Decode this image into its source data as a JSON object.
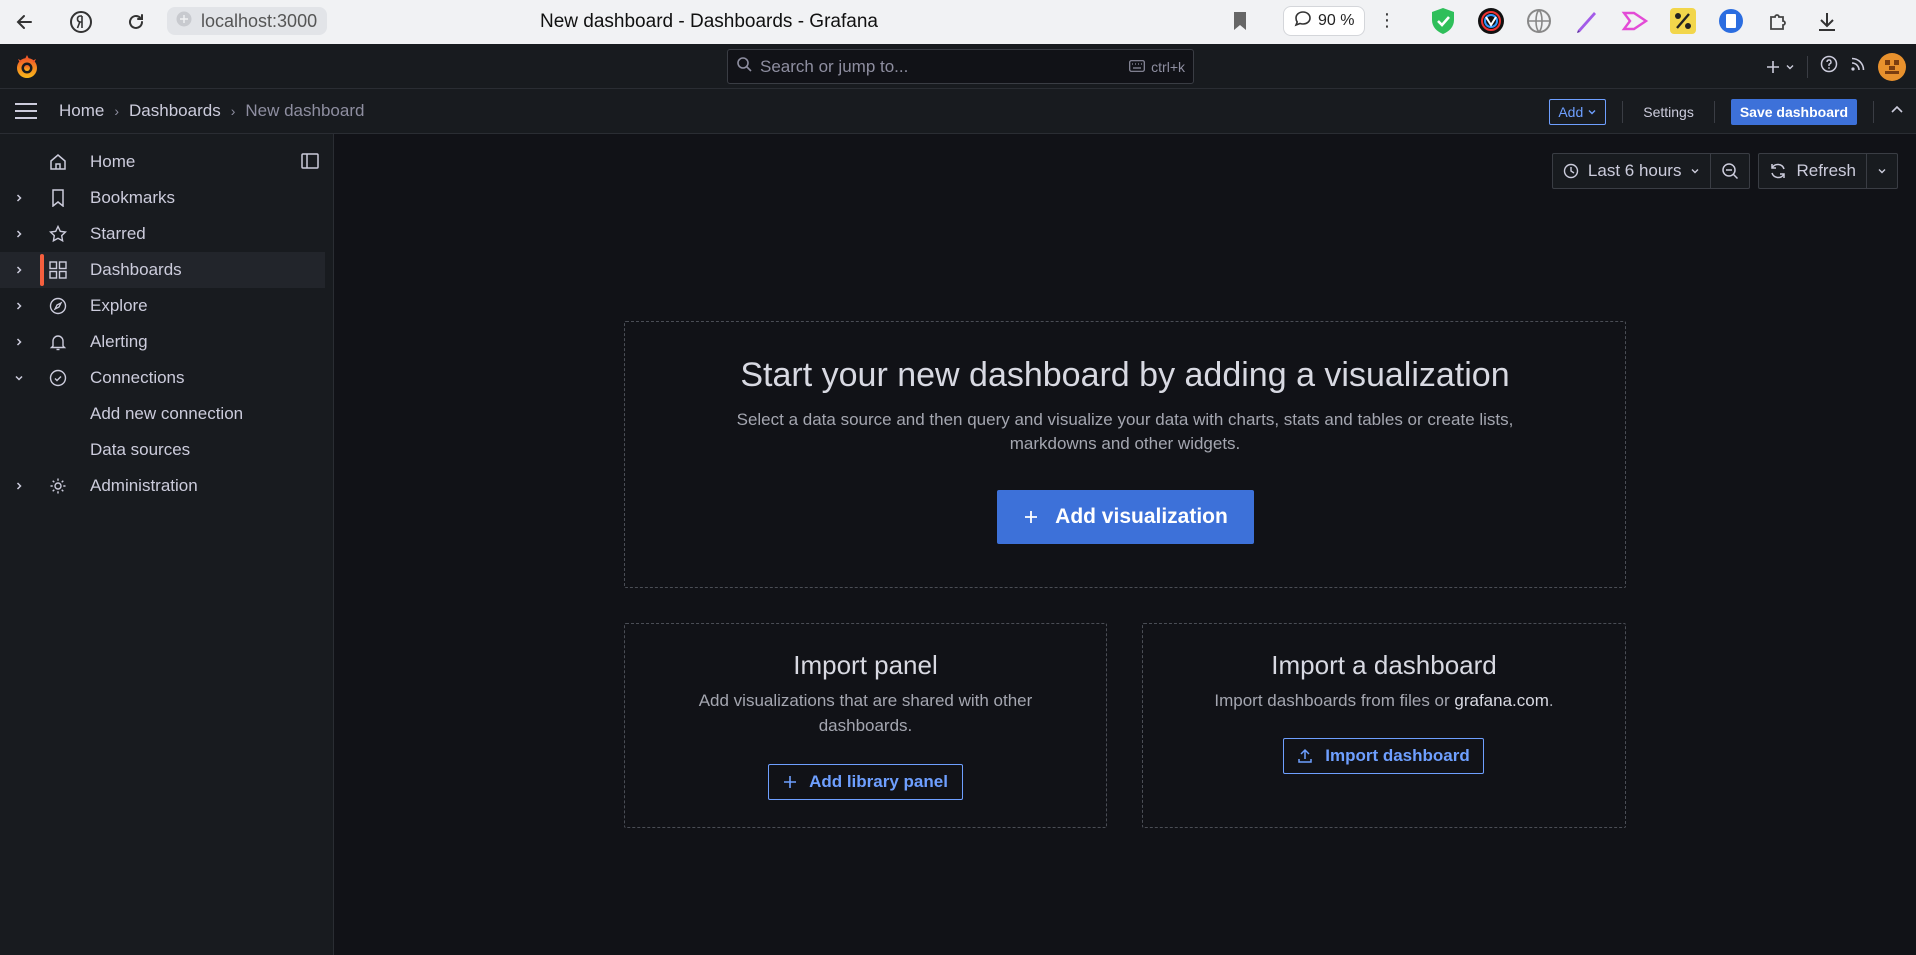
{
  "browser": {
    "url": "localhost:3000",
    "tab_title": "New dashboard - Dashboards - Grafana",
    "zoom": "90 %"
  },
  "topbar": {
    "search_placeholder": "Search or jump to...",
    "search_shortcut": "ctrl+k"
  },
  "breadcrumb": {
    "home": "Home",
    "dashboards": "Dashboards",
    "current": "New dashboard"
  },
  "toolbar": {
    "add_label": "Add",
    "settings_label": "Settings",
    "save_label": "Save dashboard"
  },
  "sidebar": {
    "items": [
      {
        "label": "Home",
        "icon": "home-icon",
        "expandable": false
      },
      {
        "label": "Bookmarks",
        "icon": "bookmark-icon",
        "expandable": true
      },
      {
        "label": "Starred",
        "icon": "star-icon",
        "expandable": true
      },
      {
        "label": "Dashboards",
        "icon": "apps-icon",
        "expandable": true,
        "active": true
      },
      {
        "label": "Explore",
        "icon": "compass-icon",
        "expandable": true
      },
      {
        "label": "Alerting",
        "icon": "bell-icon",
        "expandable": true
      },
      {
        "label": "Connections",
        "icon": "link-icon",
        "expandable": true,
        "expanded": true
      },
      {
        "label": "Add new connection",
        "sub": true
      },
      {
        "label": "Data sources",
        "sub": true
      },
      {
        "label": "Administration",
        "icon": "cog-icon",
        "expandable": true
      }
    ]
  },
  "time_controls": {
    "range_label": "Last 6 hours",
    "refresh_label": "Refresh"
  },
  "empty_state": {
    "title": "Start your new dashboard by adding a visualization",
    "description": "Select a data source and then query and visualize your data with charts, stats and tables or create lists, markdowns and other widgets.",
    "button": "Add visualization"
  },
  "import_panel": {
    "title": "Import panel",
    "description": "Add visualizations that are shared with other dashboards.",
    "button": "Add library panel"
  },
  "import_dashboard": {
    "title": "Import a dashboard",
    "description_prefix": "Import dashboards from files or ",
    "description_link": "grafana.com",
    "description_suffix": ".",
    "button": "Import dashboard"
  },
  "colors": {
    "accent": "#3d71d9",
    "link": "#6e9fff",
    "active_marker": "#f55f3e",
    "background": "#111217",
    "panel": "#181b1f"
  }
}
